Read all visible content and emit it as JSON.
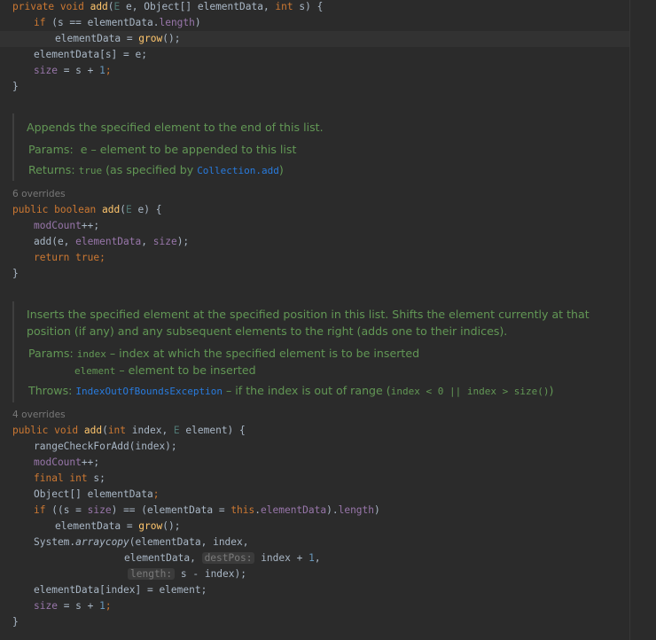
{
  "method1": {
    "l1": {
      "kw": "private void",
      "name": "add",
      "p1": "(",
      "tE": "E",
      "p2": " e, Object[] elementData, ",
      "kwInt": "int",
      "p3": " s) {"
    },
    "l2": {
      "kw": "if",
      "p1": " (s == elementData.",
      "fld": "length",
      "p2": ")"
    },
    "l3": {
      "p1": "elementData = ",
      "fn": "grow",
      "p2": "();"
    },
    "l4": "elementData[s] = e;",
    "l5": {
      "fld": "size",
      "p1": " = s + ",
      "num": "1",
      "p2": ";"
    },
    "l6": "}"
  },
  "doc1": {
    "summary": "Appends the specified element to the end of this list.",
    "params_label": "Params:",
    "params_text": "e – element to be appended to this list",
    "returns_label": "Returns:",
    "returns_code": "true",
    "returns_text": " (as specified by ",
    "returns_link": "Collection.add",
    "returns_end": ")"
  },
  "overrides1": "6 overrides",
  "method2": {
    "l1": {
      "kw": "public boolean",
      "name": "add",
      "p1": "(",
      "tE": "E",
      "p2": " e) {"
    },
    "l2": {
      "fld": "modCount",
      "p": "++;"
    },
    "l3": {
      "p1": "add(e, ",
      "f1": "elementData",
      "p2": ", ",
      "f2": "size",
      "p3": ");"
    },
    "l4": {
      "kw": "return true",
      "p": ";"
    },
    "l5": "}"
  },
  "doc2": {
    "summary1": "Inserts the specified element at the specified position in this list. Shifts the element currently at that",
    "summary2": "position (if any) and any subsequent elements to the right (adds one to their indices).",
    "params_label": "Params:",
    "param1_code": "index",
    "param1_text": " – index at which the specified element is to be inserted",
    "param2_code": "element",
    "param2_text": " – element to be inserted",
    "throws_label": "Throws:",
    "throws_link": "IndexOutOfBoundsException",
    "throws_text": " – if the index is out of range (",
    "throws_code": "index < 0 || index > size()",
    "throws_end": ")"
  },
  "overrides2": "4 overrides",
  "method3": {
    "l1": {
      "kw": "public void",
      "name": "add",
      "p1": "(",
      "kwInt": "int",
      "p2": " index, ",
      "tE": "E",
      "p3": " element) {"
    },
    "l2": "rangeCheckForAdd(index);",
    "l3": {
      "fld": "modCount",
      "p": "++;"
    },
    "l4": {
      "kw": "final int",
      "p": " s;"
    },
    "l5": {
      "p1": "Object[] elementData",
      "p2": ";"
    },
    "l6": {
      "kw": "if",
      "p1": " ((s = ",
      "f1": "size",
      "p2": ") == (elementData = ",
      "kwThis": "this",
      "p3": ".",
      "f2": "elementData",
      "p4": ").",
      "f3": "length",
      "p5": ")"
    },
    "l7": {
      "p1": "elementData = ",
      "fn": "grow",
      "p2": "();"
    },
    "l8": {
      "p1": "System.",
      "it": "arraycopy",
      "p2": "(elementData, index,"
    },
    "l9": {
      "p1": "elementData, ",
      "hint": "destPos:",
      "p2": " index + ",
      "num": "1",
      "p3": ","
    },
    "l10": {
      "hint": "length:",
      "p": " s - index);"
    },
    "l11": "elementData[index] = element;",
    "l12": {
      "fld": "size",
      "p1": " = s + ",
      "num": "1",
      "p2": ";"
    },
    "l13": "}"
  }
}
